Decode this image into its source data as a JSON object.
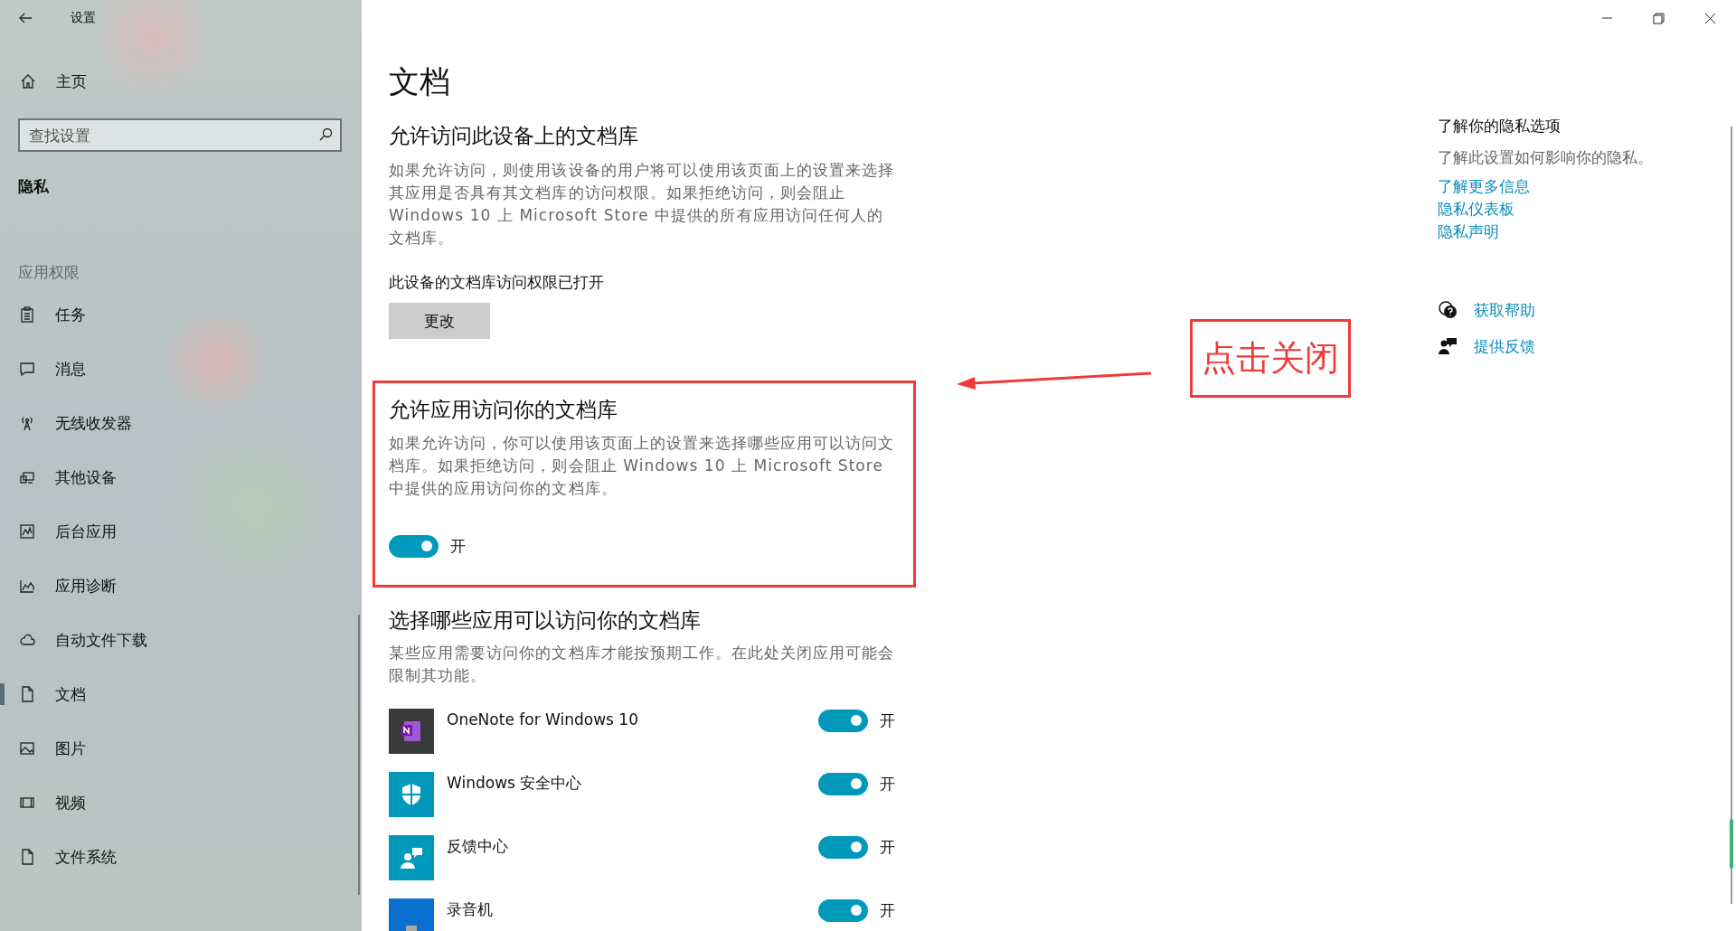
{
  "window": {
    "title": "设置"
  },
  "sidebar": {
    "home": "主页",
    "search": {
      "placeholder": "查找设置"
    },
    "section": "隐私",
    "group": "应用权限",
    "items": [
      {
        "label": "任务",
        "selected": false
      },
      {
        "label": "消息",
        "selected": false
      },
      {
        "label": "无线收发器",
        "selected": false
      },
      {
        "label": "其他设备",
        "selected": false
      },
      {
        "label": "后台应用",
        "selected": false
      },
      {
        "label": "应用诊断",
        "selected": false
      },
      {
        "label": "自动文件下载",
        "selected": false
      },
      {
        "label": "文档",
        "selected": true
      },
      {
        "label": "图片",
        "selected": false
      },
      {
        "label": "视频",
        "selected": false
      },
      {
        "label": "文件系统",
        "selected": false
      }
    ]
  },
  "page": {
    "title": "文档",
    "device_access": {
      "heading": "允许访问此设备上的文档库",
      "description": "如果允许访问，则使用该设备的用户将可以使用该页面上的设置来选择其应用是否具有其文档库的访问权限。如果拒绝访问，则会阻止 Windows 10 上 Microsoft Store 中提供的所有应用访问任何人的文档库。",
      "status": "此设备的文档库访问权限已打开",
      "button": "更改"
    },
    "app_access": {
      "heading": "允许应用访问你的文档库",
      "description": "如果允许访问，你可以使用该页面上的设置来选择哪些应用可以访问文档库。如果拒绝访问，则会阻止 Windows 10 上 Microsoft Store 中提供的应用访问你的文档库。",
      "toggle": {
        "on": true,
        "label": "开"
      }
    },
    "choose_apps": {
      "heading": "选择哪些应用可以访问你的文档库",
      "description": "某些应用需要访问你的文档库才能按预期工作。在此处关闭应用可能会限制其功能。",
      "apps": [
        {
          "name": "OneNote for Windows 10",
          "on": true,
          "label": "开"
        },
        {
          "name": "Windows 安全中心",
          "on": true,
          "label": "开"
        },
        {
          "name": "反馈中心",
          "on": true,
          "label": "开"
        },
        {
          "name": "录音机",
          "on": true,
          "label": "开"
        }
      ]
    }
  },
  "aside": {
    "heading": "了解你的隐私选项",
    "description": "了解此设置如何影响你的隐私。",
    "links": [
      "了解更多信息",
      "隐私仪表板",
      "隐私声明"
    ],
    "actions": [
      {
        "label": "获取帮助"
      },
      {
        "label": "提供反馈"
      }
    ]
  },
  "annotation": {
    "label": "点击关闭"
  }
}
